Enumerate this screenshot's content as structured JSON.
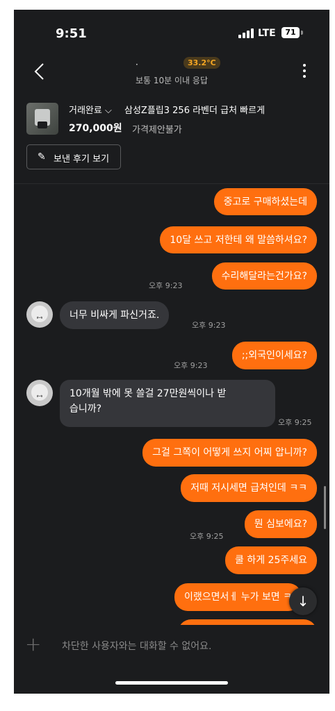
{
  "status_bar": {
    "time": "9:51",
    "network": "LTE",
    "battery": "71"
  },
  "header": {
    "chat_name": "  ·",
    "temperature": "33.2°C",
    "response_time": "보통 10분 이내 응답"
  },
  "product": {
    "trade_status": "거래완료 ⌵",
    "title": "삼성Z플립3 256 라벤더 급처 빠르게",
    "price": "270,000원",
    "price_note": "가격제안불가",
    "review_button": "보낸 후기 보기"
  },
  "messages": [
    {
      "type": "sent",
      "text": "중고로 구매하셨는데"
    },
    {
      "type": "sent",
      "text": "10달 쓰고 저한테 왜 말씀하셔요?"
    },
    {
      "type": "sent",
      "text": "수리해달라는건가요?",
      "time": "오후 9:23"
    },
    {
      "type": "recv",
      "text": "너무 비싸게 파신거죠.",
      "time": "오후 9:23"
    },
    {
      "type": "sent",
      "text": ";;외국인이세요?",
      "time": "오후 9:23"
    },
    {
      "type": "recv",
      "text": "10개월 밖에 못 쓸걸 27만원씩이나  받",
      "text2": "습니까?",
      "time": "오후 9:25"
    },
    {
      "type": "sent",
      "text": "그걸 그쪽이 어떻게 쓰지 어찌 압니까?"
    },
    {
      "type": "sent",
      "text": "저때 저시세면 급쳐인데 ㅋㅋ"
    },
    {
      "type": "sent",
      "text": "뭔 심보에요?",
      "time": "오후 9:25"
    },
    {
      "type": "sent",
      "text": "쿨 하게 25주세요"
    },
    {
      "type": "sent",
      "text": "이랬으면서ㅔ 누가 보면 ㅋ"
    }
  ],
  "input": {
    "placeholder": "차단한 사용자와는 대화할 수 없어요."
  },
  "colors": {
    "accent": "#ff6f0f",
    "background": "#1b1c1e",
    "received_bubble": "#35363a"
  }
}
